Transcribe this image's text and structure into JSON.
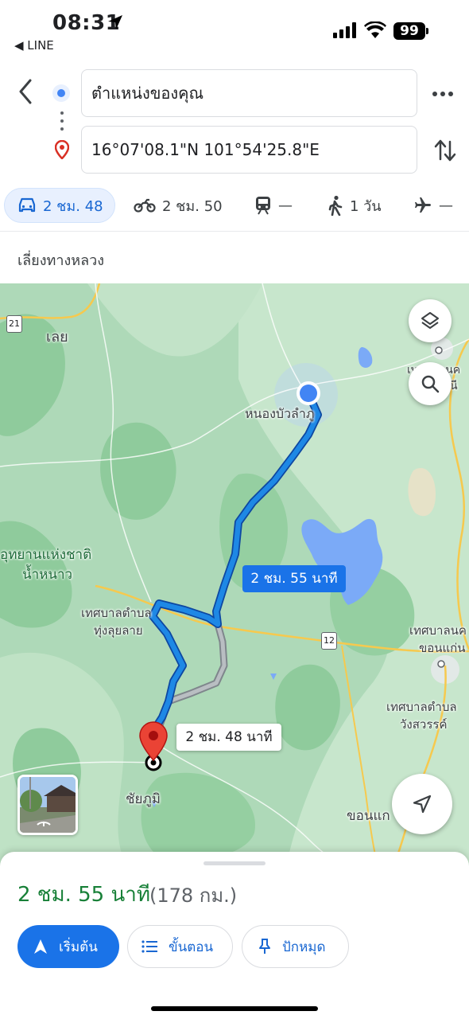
{
  "status_bar": {
    "time": "08:31",
    "back_app": "◀ LINE",
    "battery": "99"
  },
  "directions": {
    "origin": "ตำแหน่งของคุณ",
    "destination": "16°07'08.1\"N 101°54'25.8\"E"
  },
  "modes": [
    {
      "name": "drive",
      "label": "2 ชม. 48",
      "icon": "car-icon",
      "active": true
    },
    {
      "name": "motorcycle",
      "label": "2 ชม. 50",
      "icon": "motorcycle-icon"
    },
    {
      "name": "transit",
      "label": "—",
      "icon": "train-icon"
    },
    {
      "name": "walk",
      "label": "1 วัน",
      "icon": "walk-icon"
    },
    {
      "name": "flight",
      "label": "—",
      "icon": "plane-icon"
    }
  ],
  "route_note": "เลี่ยงทางหลวง",
  "map": {
    "labels": {
      "loei": "เลย",
      "nong_bua_lamphu": "หนองบัวลำภู",
      "national_park_1": "อุทยานแห่งชาติ",
      "national_park_2": "น้ำหนาว",
      "thung_lui_lai_1": "เทศบาลตำบล",
      "thung_lui_lai_2": "ทุ่งลุยลาย",
      "khon_kaen_muni_1": "เทศบาลนค",
      "khon_kaen_muni_2": "ขอนแก่น",
      "wang_sawat_1": "เทศบาลตำบล",
      "wang_sawat_2": "วังสวรรค์",
      "chaiyaphum": "ชัยภูมิ",
      "khon_kaen": "ขอนแก",
      "udon_1": "เทศบาลนค",
      "udon_2": "นี"
    },
    "shields": {
      "r21": "21",
      "r12": "12"
    },
    "route_time": "2 ชม. 55 นาที",
    "alt_route_time": "2 ชม. 48 นาที",
    "colors": {
      "route": "#1a73e8",
      "alt_route": "#9aa0a6",
      "water": "#7baaf7",
      "land": "#aed9b8"
    }
  },
  "sheet": {
    "duration": "2 ชม. 55 นาที",
    "distance": "(178 กม.)",
    "buttons": {
      "start": "เริ่มต้น",
      "steps": "ขั้นตอน",
      "pin": "ปักหมุด"
    }
  }
}
